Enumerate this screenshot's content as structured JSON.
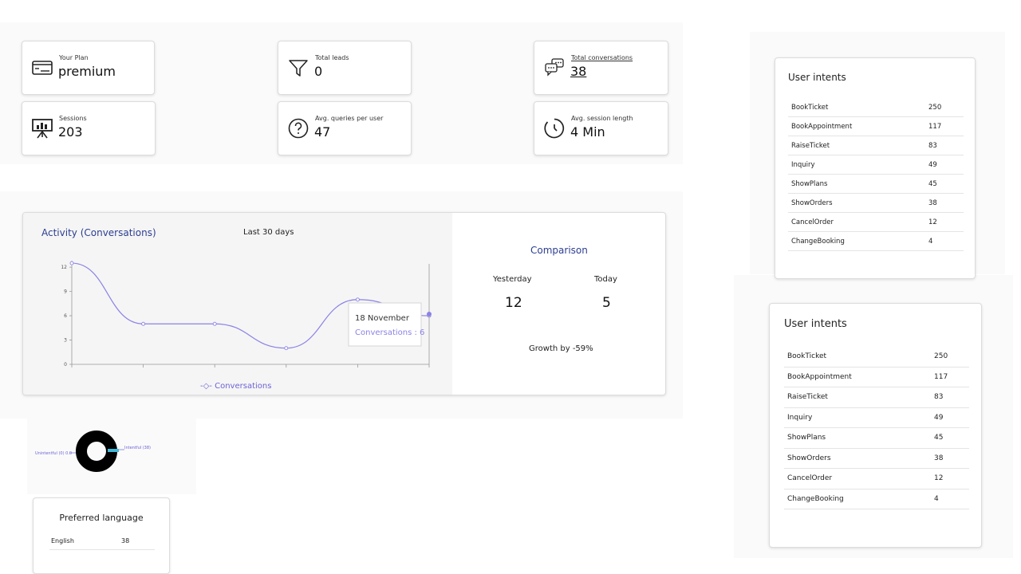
{
  "stats": [
    {
      "label": "Your Plan",
      "value": "premium",
      "icon": "credit-card-icon"
    },
    {
      "label": "Total leads",
      "value": "0",
      "icon": "funnel-icon"
    },
    {
      "label": "Total conversations",
      "value": "38",
      "icon": "chat-bubbles-icon"
    },
    {
      "label": "Sessions",
      "value": "203",
      "icon": "presentation-board-icon"
    },
    {
      "label": "Avg. queries per user",
      "value": "47",
      "icon": "question-circle-icon"
    },
    {
      "label": "Avg. session length",
      "value": "4 Min",
      "icon": "clock-icon"
    }
  ],
  "activity": {
    "title": "Activity (Conversations)",
    "range": "Last 30 days",
    "legend": "Conversations",
    "tooltip": {
      "date": "18 November",
      "text": "Conversations : 6"
    }
  },
  "chart_data": {
    "type": "line",
    "title": "Activity (Conversations)",
    "series": [
      {
        "name": "Conversations",
        "values": [
          12.5,
          5,
          5,
          2,
          8,
          6
        ]
      }
    ],
    "yticks": [
      "0",
      "3",
      "6",
      "9",
      "12"
    ],
    "ylim": [
      0,
      13
    ],
    "color": "#8a82e6"
  },
  "comparison": {
    "title": "Comparison",
    "yesterday_label": "Yesterday",
    "today_label": "Today",
    "yesterday_value": "12",
    "today_value": "5",
    "growth": "Growth by -59%"
  },
  "donut": {
    "left_label": "Unintentful (0) 0.0",
    "right_label": "Intentful (38)"
  },
  "preferred_language": {
    "title": "Preferred language",
    "rows": [
      {
        "language": "English",
        "count": "38"
      }
    ]
  },
  "intents_top": {
    "title": "User intents",
    "rows": [
      {
        "name": "BookTicket",
        "count": "250"
      },
      {
        "name": "BookAppointment",
        "count": "117"
      },
      {
        "name": "RaiseTicket",
        "count": "83"
      },
      {
        "name": "Inquiry",
        "count": "49"
      },
      {
        "name": "ShowPlans",
        "count": "45"
      },
      {
        "name": "ShowOrders",
        "count": "38"
      },
      {
        "name": "CancelOrder",
        "count": "12"
      },
      {
        "name": "ChangeBooking",
        "count": "4"
      }
    ]
  },
  "intents_bottom": {
    "title": "User intents",
    "rows": [
      {
        "name": "BookTicket",
        "count": "250"
      },
      {
        "name": "BookAppointment",
        "count": "117"
      },
      {
        "name": "RaiseTicket",
        "count": "83"
      },
      {
        "name": "Inquiry",
        "count": "49"
      },
      {
        "name": "ShowPlans",
        "count": "45"
      },
      {
        "name": "ShowOrders",
        "count": "38"
      },
      {
        "name": "CancelOrder",
        "count": "12"
      },
      {
        "name": "ChangeBooking",
        "count": "4"
      }
    ]
  },
  "colors": {
    "accent": "#2c3e91",
    "line": "#8a82e6",
    "donut": "#000000",
    "donut_slice": "#3fb9d8"
  }
}
